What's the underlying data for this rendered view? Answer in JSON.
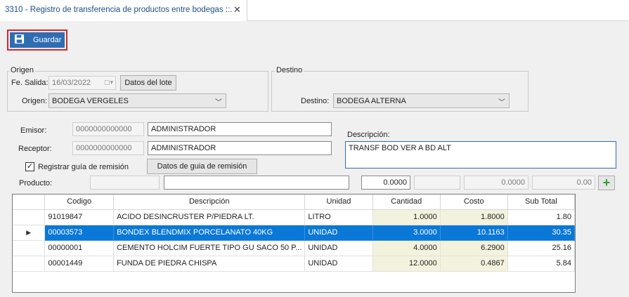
{
  "tab": {
    "title": "3310 - Registro de transferencia de productos entre bodegas ::.",
    "close": "✕"
  },
  "toolbar": {
    "save_label": "Guardar"
  },
  "origen": {
    "legend": "Origen",
    "fecha_label": "Fe. Salida:",
    "fecha_value": "16/03/2022",
    "lote_button": "Datos del lote",
    "origen_label": "Origen:",
    "origen_value": "BODEGA VERGELES"
  },
  "destino": {
    "legend": "Destino",
    "destino_label": "Destino:",
    "destino_value": "BODEGA ALTERNA"
  },
  "emisor": {
    "label": "Emisor:",
    "code": "0000000000000",
    "name": "ADMINISTRADOR"
  },
  "receptor": {
    "label": "Receptor:",
    "code": "0000000000000",
    "name": "ADMINISTRADOR"
  },
  "descripcion": {
    "label": "Descripción:",
    "value": "TRANSF BOD VER A BD ALT"
  },
  "guia": {
    "checkbox_label": "Registrar guía de remisión",
    "checked": true,
    "button": "Datos de guia de remisión"
  },
  "producto": {
    "label": "Producto:",
    "code": "",
    "name": "",
    "cantidad": "0.0000",
    "extra": "",
    "costo": "0.0000",
    "subtotal": "0.00"
  },
  "grid": {
    "columns": [
      "Codigo",
      "Descripción",
      "Unidad",
      "Cantidad",
      "Costo",
      "Sub Total"
    ],
    "rows": [
      {
        "codigo": "91019847",
        "descripcion": "ACIDO DESINCRUSTER P/PIEDRA LT.",
        "unidad": "LITRO",
        "cantidad": "1.0000",
        "costo": "1.8000",
        "subtotal": "1.80",
        "selected": false
      },
      {
        "codigo": "00003573",
        "descripcion": "BONDEX BLENDMIX PORCELANATO 40KG",
        "unidad": "UNIDAD",
        "cantidad": "3.0000",
        "costo": "10.1163",
        "subtotal": "30.35",
        "selected": true
      },
      {
        "codigo": "00000001",
        "descripcion": "CEMENTO HOLCIM FUERTE TIPO GU SACO 50 P...",
        "unidad": "UNIDAD",
        "cantidad": "4.0000",
        "costo": "6.2900",
        "subtotal": "25.16",
        "selected": false
      },
      {
        "codigo": "00001449",
        "descripcion": "FUNDA DE PIEDRA CHISPA",
        "unidad": "UNIDAD",
        "cantidad": "12.0000",
        "costo": "0.4867",
        "subtotal": "5.84",
        "selected": false
      }
    ]
  },
  "colors": {
    "accent": "#2f6db3",
    "highlight_border": "#d9242b",
    "selection": "#0a78d7",
    "editable_cell": "#f3f2dd",
    "add_icon": "#2ea02e"
  },
  "icons": {
    "save": "floppy-disk-icon",
    "calendar": "calendar-icon",
    "add": "plus-icon",
    "row_indicator": "triangle-right-icon"
  }
}
